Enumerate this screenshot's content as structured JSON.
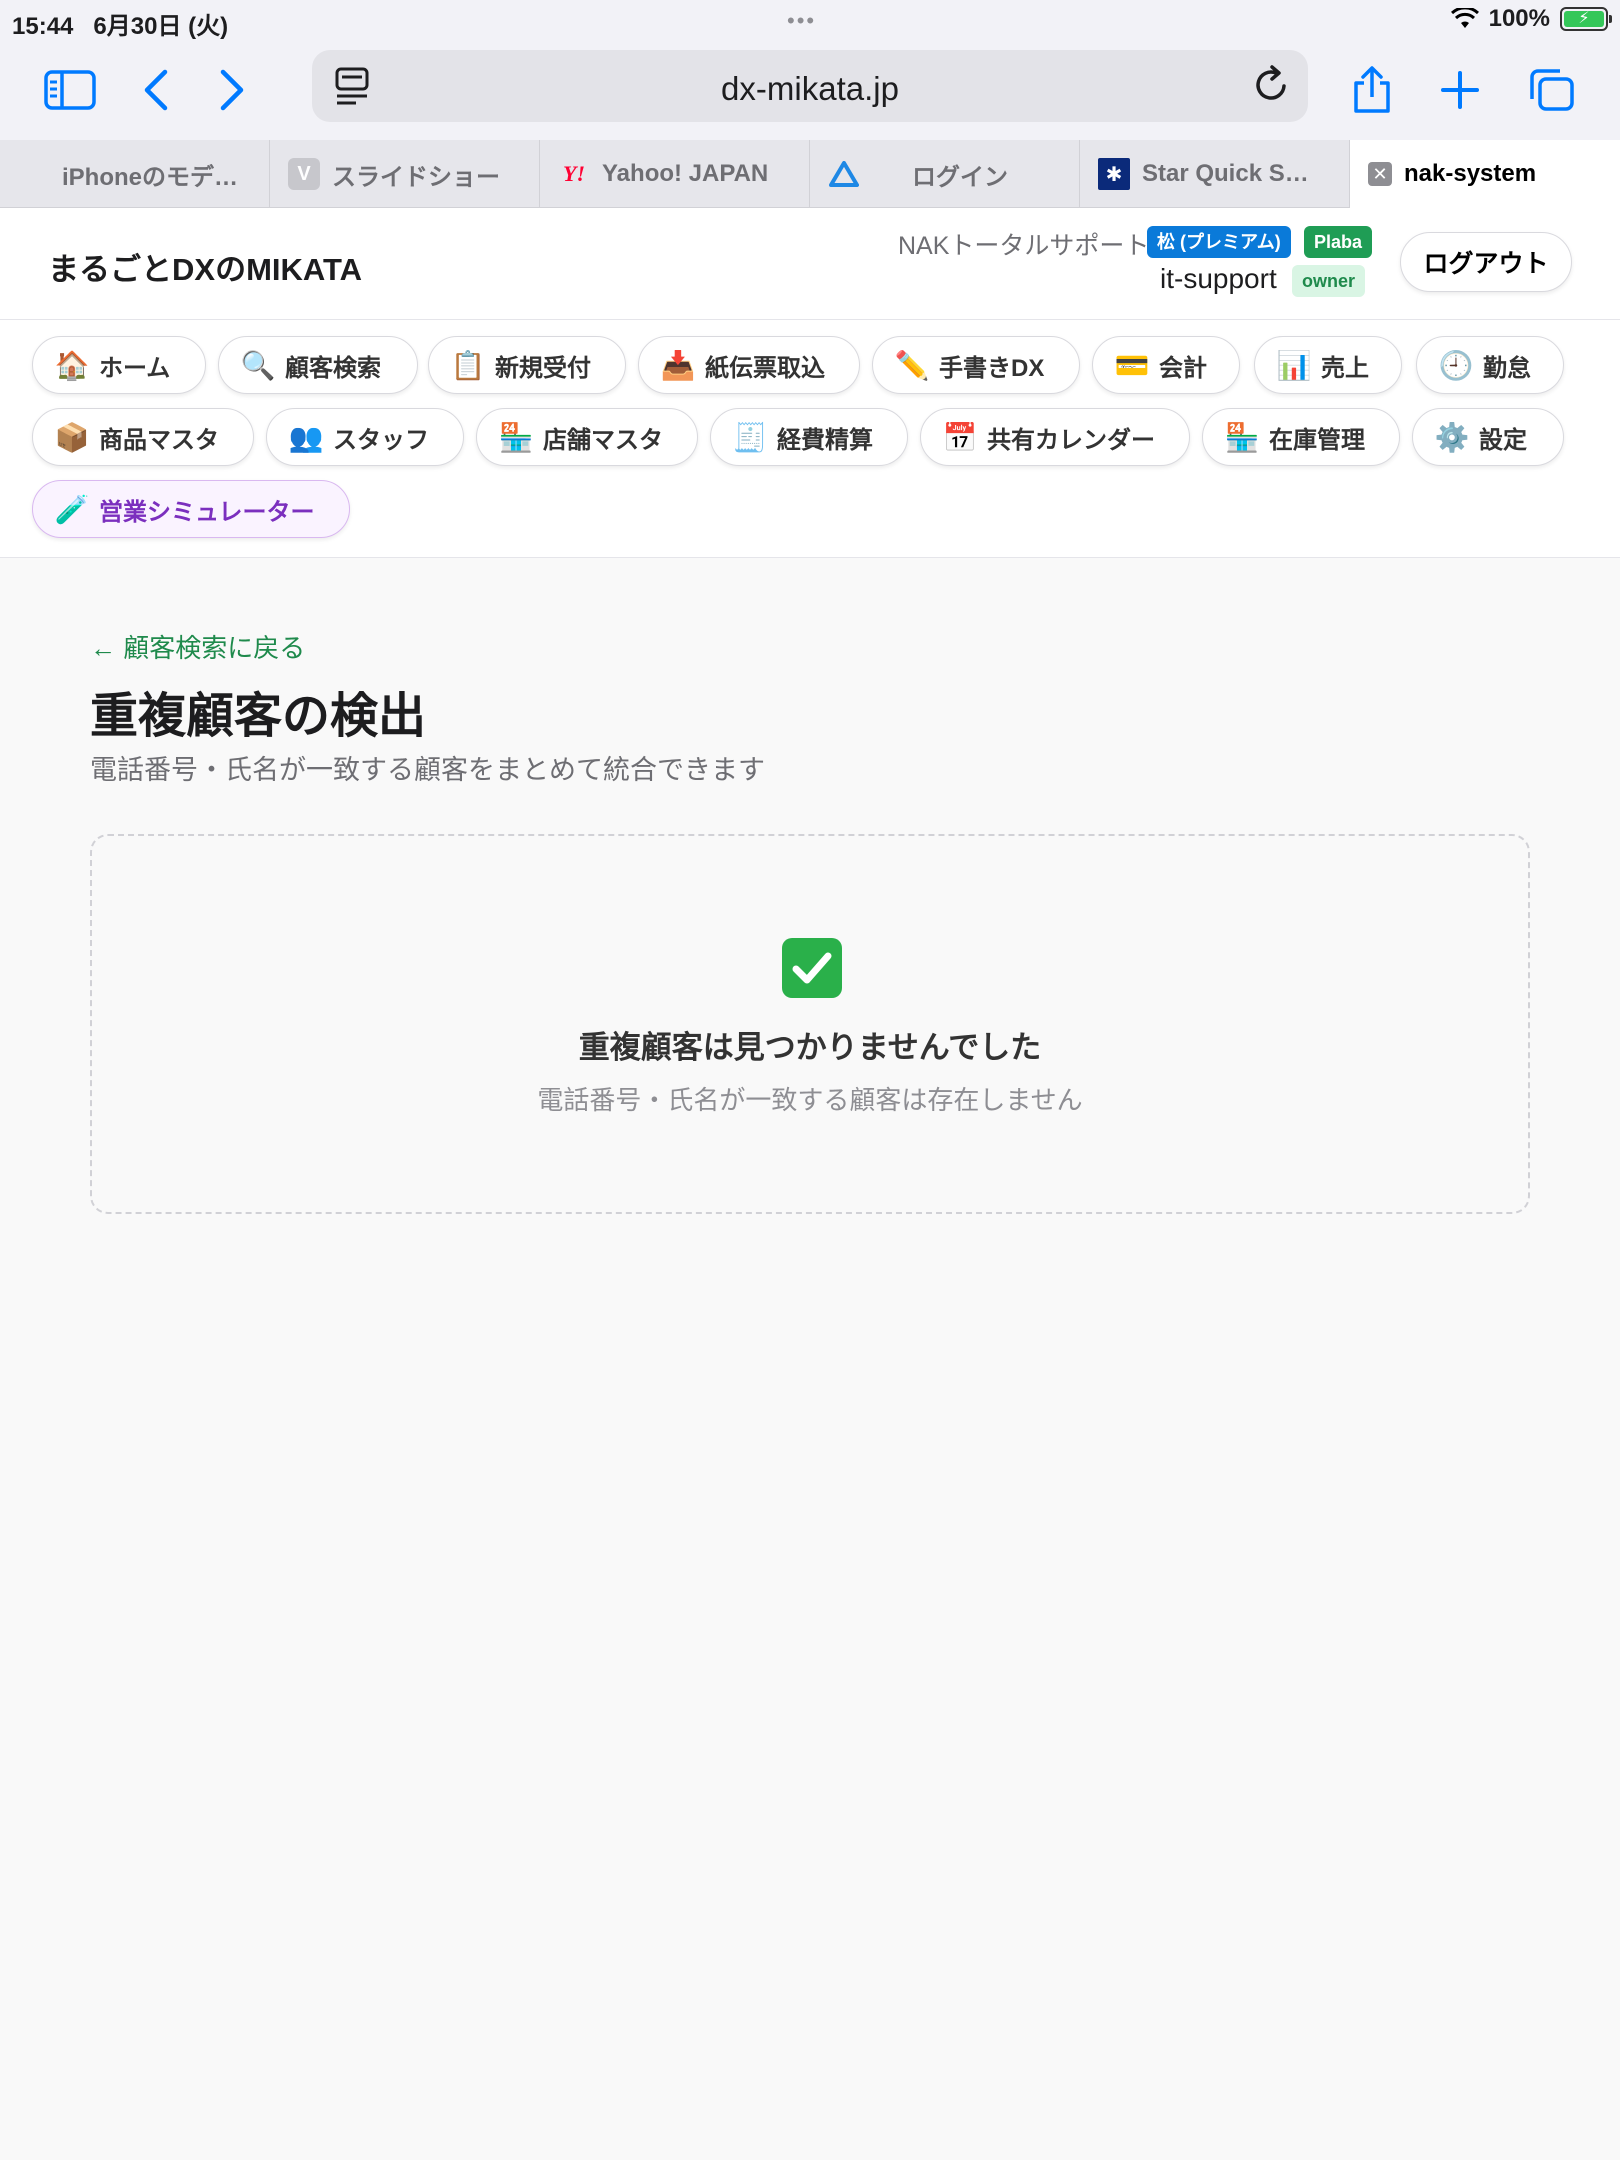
{
  "status_bar": {
    "time": "15:44",
    "date": "6月30日 (火)",
    "battery": "100%"
  },
  "browser": {
    "url": "dx-mikata.jp",
    "tabs": [
      {
        "label": "iPhoneのモデ…",
        "icon": "apple-icon"
      },
      {
        "label": "スライドショー",
        "icon": "v-icon"
      },
      {
        "label": "Yahoo! JAPAN",
        "icon": "yahoo-icon"
      },
      {
        "label": "ログイン",
        "icon": "drive-icon"
      },
      {
        "label": "Star Quick S…",
        "icon": "star-quick-icon"
      },
      {
        "label": "nak-system",
        "icon": "close-icon",
        "active": true
      }
    ]
  },
  "header": {
    "brand": "まるごとDXのMIKATA",
    "org_name": "NAKトータルサポート",
    "plan_badge": "松 (プレミアム)",
    "store_badge": "Plaba",
    "username": "it-support",
    "role_badge": "owner",
    "logout_label": "ログアウト"
  },
  "nav": {
    "items": [
      {
        "label": "ホーム",
        "icon": "house-icon",
        "glyph": "🏠"
      },
      {
        "label": "顧客検索",
        "icon": "magnifier-icon",
        "glyph": "🔍"
      },
      {
        "label": "新規受付",
        "icon": "clipboard-icon",
        "glyph": "📋"
      },
      {
        "label": "紙伝票取込",
        "icon": "inbox-tray-icon",
        "glyph": "📥"
      },
      {
        "label": "手書きDX",
        "icon": "pencil-icon",
        "glyph": "✏️"
      },
      {
        "label": "会計",
        "icon": "credit-card-icon",
        "glyph": "💳"
      },
      {
        "label": "売上",
        "icon": "bar-chart-icon",
        "glyph": "📊"
      },
      {
        "label": "勤怠",
        "icon": "clock-icon",
        "glyph": "🕘"
      },
      {
        "label": "商品マスタ",
        "icon": "package-icon",
        "glyph": "📦"
      },
      {
        "label": "スタッフ",
        "icon": "people-icon",
        "glyph": "👥"
      },
      {
        "label": "店舗マスタ",
        "icon": "store-icon",
        "glyph": "🏪"
      },
      {
        "label": "経費精算",
        "icon": "receipt-icon",
        "glyph": "🧾"
      },
      {
        "label": "共有カレンダー",
        "icon": "calendar-icon",
        "glyph": "📅"
      },
      {
        "label": "在庫管理",
        "icon": "store-icon",
        "glyph": "🏪"
      },
      {
        "label": "設定",
        "icon": "gear-icon",
        "glyph": "⚙️"
      },
      {
        "label": "営業シミュレーター",
        "icon": "test-tube-icon",
        "glyph": "🧪"
      }
    ]
  },
  "main": {
    "back_link": "← 顧客検索に戻る",
    "title": "重複顧客の検出",
    "subtitle": "電話番号・氏名が一致する顧客をまとめて統合できます",
    "empty_state": {
      "icon": "check-mark-icon",
      "title": "重複顧客は見つかりませんでした",
      "message": "電話番号・氏名が一致する顧客は存在しません"
    }
  },
  "colors": {
    "accent": "#007aff",
    "link": "#1f8a4c",
    "plan_badge": "#0a7ad9",
    "store_badge": "#1f9d55",
    "simulator": "#7b2fbe"
  }
}
